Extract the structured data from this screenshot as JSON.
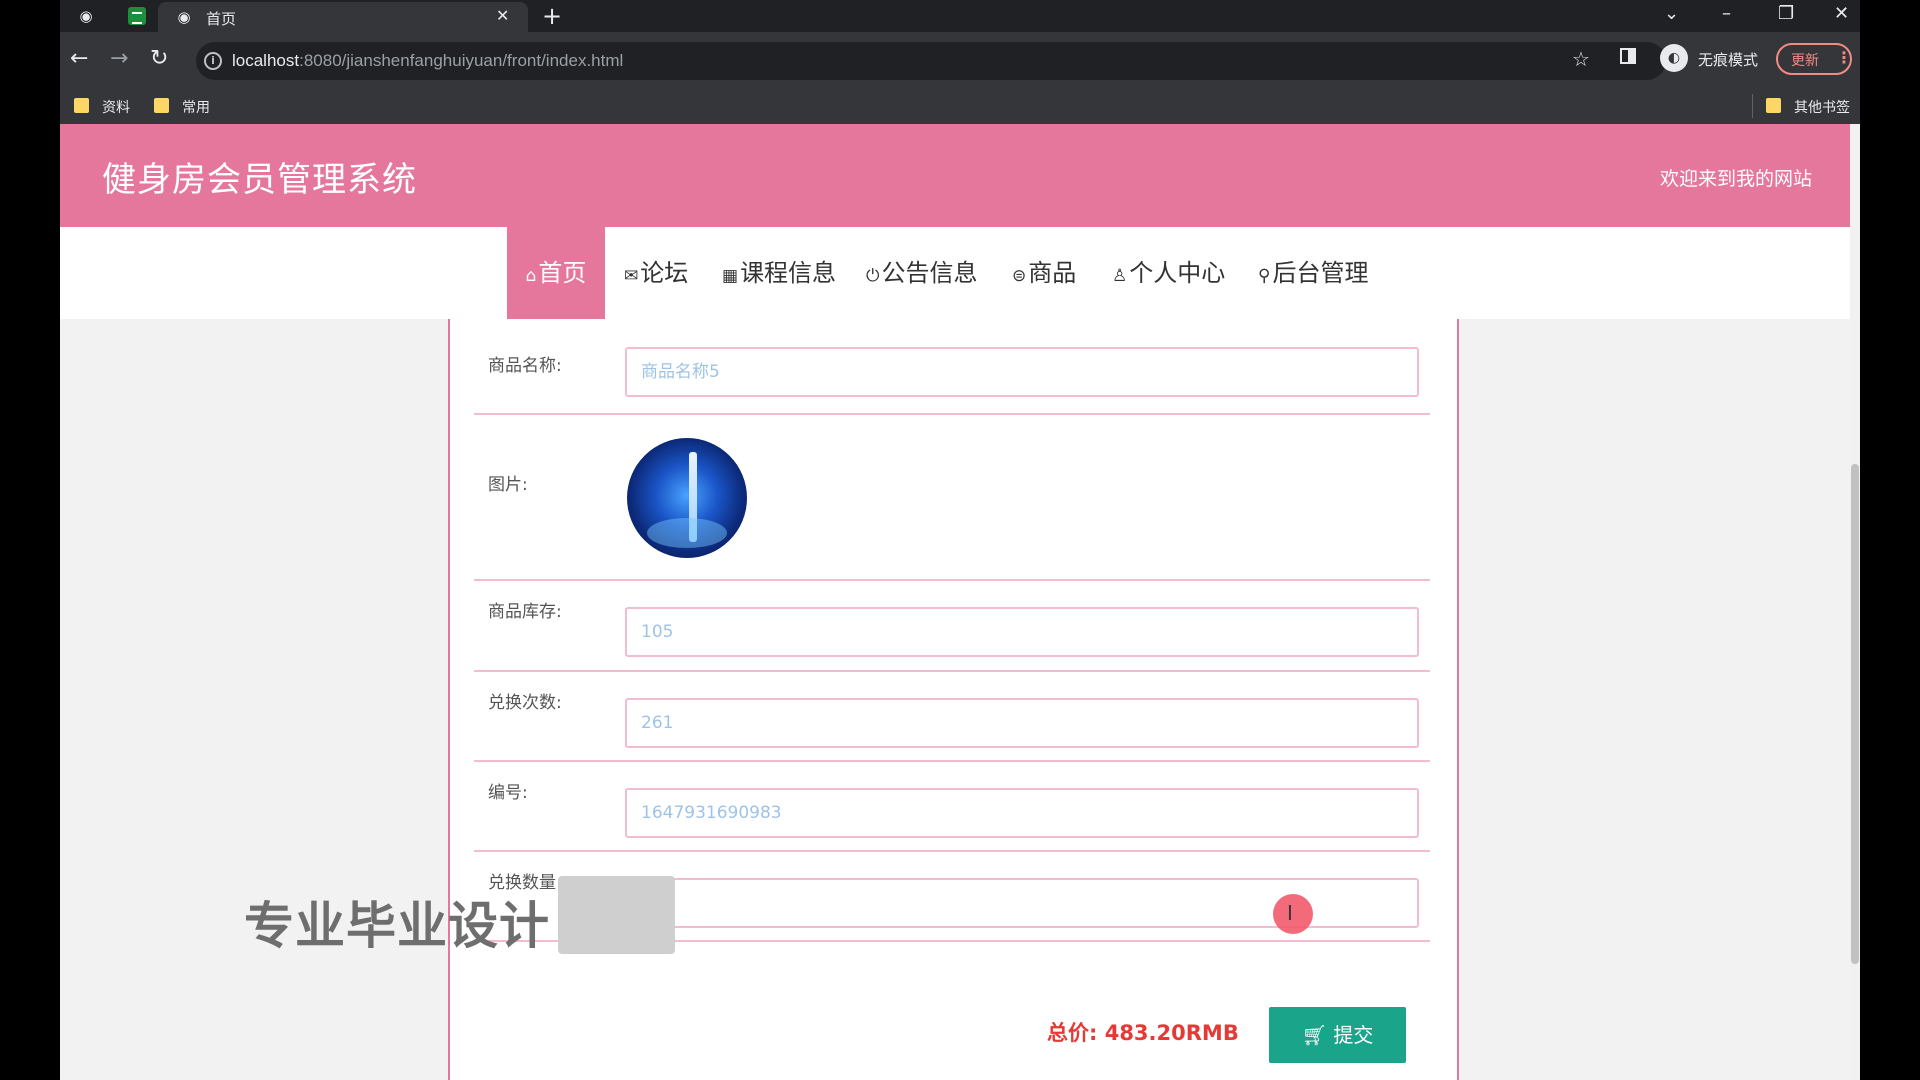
{
  "browser": {
    "tab_title": "首页",
    "url_host": "localhost",
    "url_rest": ":8080/jianshenfanghuiyuan/front/index.html",
    "incognito_label": "无痕模式",
    "update_label": "更新",
    "bookmarks": [
      "资料",
      "常用"
    ],
    "other_bookmarks": "其他书签"
  },
  "site": {
    "title": "健身房会员管理系统",
    "welcome": "欢迎来到我的网站",
    "nav": [
      "首页",
      "论坛",
      "课程信息",
      "公告信息",
      "商品",
      "个人中心",
      "后台管理"
    ],
    "active_nav": "首页"
  },
  "form": {
    "name_label": "商品名称:",
    "name_value": "商品名称5",
    "image_label": "图片:",
    "stock_label": "商品库存:",
    "stock_value": "105",
    "exchange_label": "兑换次数:",
    "exchange_value": "261",
    "code_label": "编号:",
    "code_value": "1647931690983",
    "qty_label": "兑换数量",
    "qty_value": "",
    "total": "总价: 483.20RMB",
    "submit_label": "提交"
  },
  "overlay": {
    "watermark": "专业毕业设计"
  }
}
